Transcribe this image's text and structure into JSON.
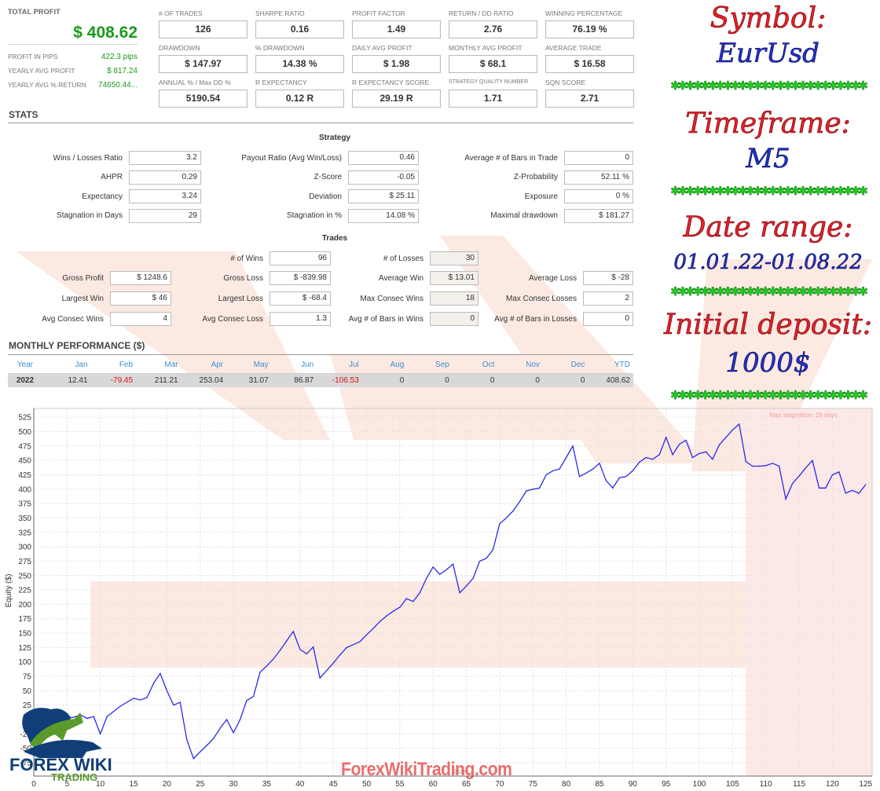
{
  "summary": {
    "total_profit_label": "TOTAL PROFIT",
    "total_profit_value": "$ 408.62",
    "rows": [
      {
        "label": "PROFIT IN PIPS",
        "value": "422.3 pips"
      },
      {
        "label": "YEARLY AVG PROFIT",
        "value": "$ 817.24"
      },
      {
        "label": "YEARLY AVG % RETURN",
        "value": "74650.44..."
      }
    ]
  },
  "metrics": [
    {
      "label": "# OF TRADES",
      "value": "126"
    },
    {
      "label": "SHARPE RATIO",
      "value": "0.16"
    },
    {
      "label": "PROFIT FACTOR",
      "value": "1.49"
    },
    {
      "label": "RETURN / DD RATIO",
      "value": "2.76"
    },
    {
      "label": "WINNING PERCENTAGE",
      "value": "76.19 %"
    },
    {
      "label": "DRAWDOWN",
      "value": "$ 147.97"
    },
    {
      "label": "% DRAWDOWN",
      "value": "14.38 %"
    },
    {
      "label": "DAILY AVG PROFIT",
      "value": "$ 1.98"
    },
    {
      "label": "MONTHLY AVG PROFIT",
      "value": "$ 68.1"
    },
    {
      "label": "AVERAGE TRADE",
      "value": "$ 16.58"
    },
    {
      "label": "ANNUAL % / Max DD %",
      "value": "5190.54"
    },
    {
      "label": "R EXPECTANCY",
      "value": "0.12 R"
    },
    {
      "label": "R EXPECTANCY SCORE",
      "value": "29.19 R"
    },
    {
      "label": "STRATEGY QUALITY NUMBER",
      "value": "1.71"
    },
    {
      "label": "SQN SCORE",
      "value": "2.71"
    }
  ],
  "stats": {
    "title": "STATS",
    "strategy_title": "Strategy",
    "strategy": [
      [
        {
          "label": "Wins / Losses Ratio",
          "value": "3.2"
        },
        {
          "label": "Payout Ratio (Avg Win/Loss)",
          "value": "0.46"
        },
        {
          "label": "Average # of Bars in Trade",
          "value": "0"
        }
      ],
      [
        {
          "label": "AHPR",
          "value": "0.29"
        },
        {
          "label": "Z-Score",
          "value": "-0.05"
        },
        {
          "label": "Z-Probability",
          "value": "52.11 %"
        }
      ],
      [
        {
          "label": "Expectancy",
          "value": "3.24"
        },
        {
          "label": "Deviation",
          "value": "$ 25.11"
        },
        {
          "label": "Exposure",
          "value": "0 %"
        }
      ],
      [
        {
          "label": "Stagnation in Days",
          "value": "29"
        },
        {
          "label": "Stagnation in %",
          "value": "14.08 %"
        },
        {
          "label": "Maximal drawdown",
          "value": "$ 181.27"
        }
      ]
    ],
    "trades_title": "Trades",
    "wins": {
      "label": "# of Wins",
      "value": "96"
    },
    "losses": {
      "label": "# of Losses",
      "value": "30"
    },
    "trades": [
      [
        {
          "label": "Gross Profit",
          "value": "$ 1248.6"
        },
        {
          "label": "Gross Loss",
          "value": "$ -839.98"
        },
        {
          "label": "Average Win",
          "value": "$ 13.01"
        },
        {
          "label": "Average Loss",
          "value": "$ -28"
        }
      ],
      [
        {
          "label": "Largest Win",
          "value": "$ 46"
        },
        {
          "label": "Largest Loss",
          "value": "$ -68.4"
        },
        {
          "label": "Max Consec Wins",
          "value": "18"
        },
        {
          "label": "Max Consec Losses",
          "value": "2"
        }
      ],
      [
        {
          "label": "Avg Consec Wins",
          "value": "4"
        },
        {
          "label": "Avg Consec Loss",
          "value": "1.3"
        },
        {
          "label": "Avg # of Bars in Wins",
          "value": "0"
        },
        {
          "label": "Avg # of Bars in Losses",
          "value": "0"
        }
      ]
    ]
  },
  "monthly": {
    "title": "MONTHLY PERFORMANCE ($)",
    "headers": [
      "Year",
      "Jan",
      "Feb",
      "Mar",
      "Apr",
      "May",
      "Jun",
      "Jul",
      "Aug",
      "Sep",
      "Oct",
      "Nov",
      "Dec",
      "YTD"
    ],
    "rows": [
      [
        "2022",
        "12.41",
        "-79.45",
        "211.21",
        "253.04",
        "31.07",
        "86.87",
        "-106.53",
        "0",
        "0",
        "0",
        "0",
        "0",
        "408.62"
      ]
    ]
  },
  "promo": {
    "symbol_label": "Symbol:",
    "symbol_value": "EurUsd",
    "timeframe_label": "Timeframe:",
    "timeframe_value": "M5",
    "date_label": "Date range:",
    "date_value": "01.01.22-01.08.22",
    "deposit_label": "Initial deposit:",
    "deposit_value": "1000$",
    "stars": "✱✱✱✱✱✱✱✱✱✱✱✱✱✱✱✱✱✱✱✱✱✱✱✱✱✱"
  },
  "branding": {
    "site": "ForexWikiTrading.com",
    "logo_top": "FOREX WIKI",
    "logo_bottom": "TRADING",
    "watermark": "www.FX-VIP.pro"
  },
  "colors": {
    "profit_green": "#1a9a1a",
    "negative_red": "#e01010",
    "line_blue": "#2a2ae8",
    "stagnation_fill": "#fde8e8",
    "header_blue": "#3a8fd0"
  },
  "chart_data": {
    "type": "line",
    "title": "",
    "xlabel": "",
    "ylabel": "Equity ($)",
    "xlim": [
      0,
      126
    ],
    "ylim": [
      -90,
      540
    ],
    "xticks": [
      0,
      5,
      10,
      15,
      20,
      25,
      30,
      35,
      40,
      45,
      50,
      55,
      60,
      65,
      70,
      75,
      80,
      85,
      90,
      95,
      100,
      105,
      110,
      115,
      120,
      125
    ],
    "yticks": [
      -75,
      -50,
      -25,
      0,
      25,
      50,
      75,
      100,
      125,
      150,
      175,
      200,
      225,
      250,
      275,
      300,
      325,
      350,
      375,
      400,
      425,
      450,
      475,
      500,
      525
    ],
    "ytick_labels": [
      "-75",
      "-50",
      "-25",
      "0",
      "25",
      "50",
      "75",
      "100",
      "125",
      "150",
      "175",
      "200",
      "225",
      "250",
      "275",
      "300",
      "325",
      "350",
      "375",
      "400",
      "425",
      "450",
      "475",
      "500",
      "525"
    ],
    "grid": true,
    "year_marker": {
      "x": 64,
      "label": "2022"
    },
    "stagnation": {
      "x_start": 107,
      "x_end": 126,
      "label": "Max stagnation: 29 days"
    },
    "series": [
      {
        "name": "Equity",
        "x": [
          0,
          1,
          2,
          3,
          4,
          5,
          6,
          7,
          8,
          9,
          10,
          11,
          12,
          13,
          14,
          15,
          16,
          17,
          18,
          19,
          20,
          21,
          22,
          23,
          24,
          25,
          26,
          27,
          28,
          29,
          30,
          31,
          32,
          33,
          34,
          35,
          36,
          37,
          38,
          39,
          40,
          41,
          42,
          43,
          44,
          45,
          46,
          47,
          48,
          49,
          50,
          51,
          52,
          53,
          54,
          55,
          56,
          57,
          58,
          59,
          60,
          61,
          62,
          63,
          64,
          65,
          66,
          67,
          68,
          69,
          70,
          71,
          72,
          73,
          74,
          75,
          76,
          77,
          78,
          79,
          80,
          81,
          82,
          83,
          84,
          85,
          86,
          87,
          88,
          89,
          90,
          91,
          92,
          93,
          94,
          95,
          96,
          97,
          98,
          99,
          100,
          101,
          102,
          103,
          104,
          105,
          106,
          107,
          108,
          109,
          110,
          111,
          112,
          113,
          114,
          115,
          116,
          117,
          118,
          119,
          120,
          121,
          122,
          123,
          124,
          125
        ],
        "values": [
          0,
          3,
          6,
          8,
          5,
          2,
          4,
          8,
          2,
          5,
          -25,
          5,
          14,
          23,
          30,
          37,
          34,
          38,
          63,
          80,
          50,
          25,
          30,
          -35,
          -68,
          -56,
          -45,
          -33,
          -15,
          0,
          -23,
          0,
          33,
          40,
          82,
          93,
          105,
          120,
          137,
          153,
          122,
          114,
          126,
          72,
          85,
          98,
          112,
          125,
          130,
          135,
          147,
          158,
          170,
          180,
          188,
          195,
          210,
          205,
          220,
          245,
          265,
          252,
          260,
          270,
          220,
          232,
          245,
          275,
          280,
          295,
          340,
          350,
          362,
          378,
          397,
          400,
          402,
          425,
          432,
          435,
          455,
          475,
          422,
          428,
          435,
          445,
          415,
          402,
          420,
          422,
          432,
          447,
          455,
          452,
          460,
          490,
          460,
          478,
          485,
          455,
          462,
          465,
          452,
          477,
          490,
          503,
          513,
          448,
          440,
          440,
          441,
          445,
          440,
          383,
          410,
          423,
          437,
          450,
          402,
          402,
          425,
          430,
          393,
          398,
          393,
          408
        ]
      }
    ]
  }
}
